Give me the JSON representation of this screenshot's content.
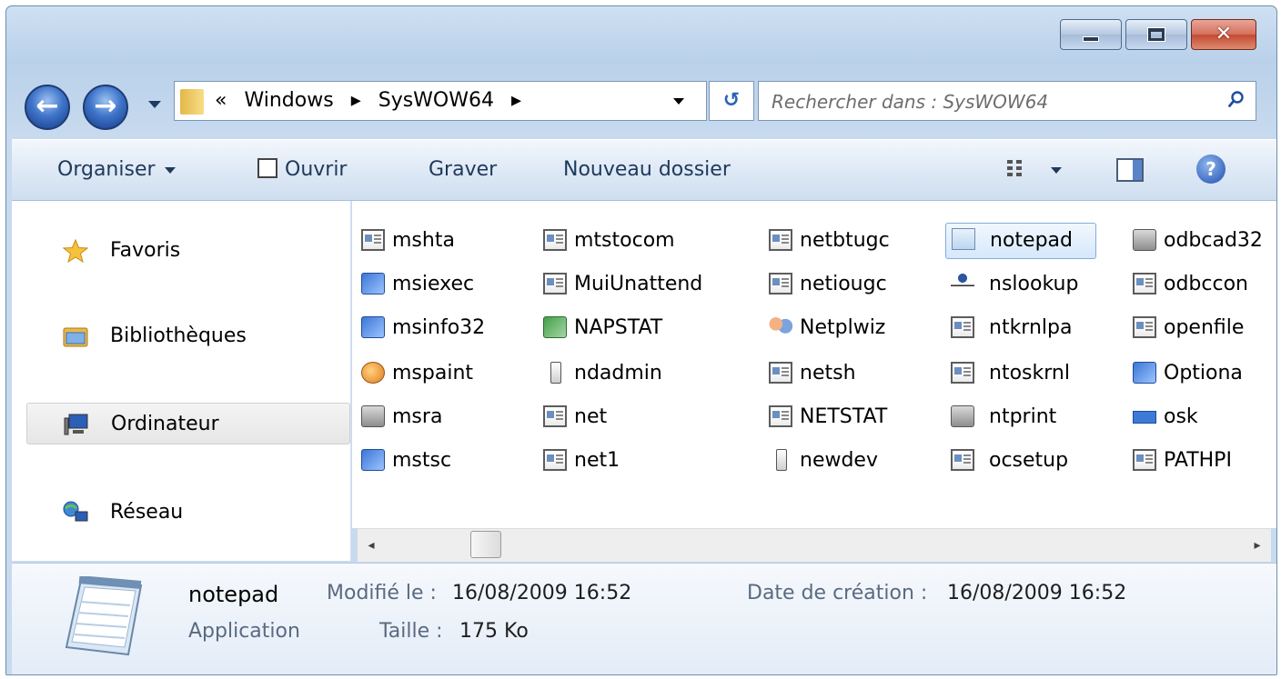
{
  "window": {
    "caption_buttons": {
      "minimize": "",
      "maximize": "",
      "close": "✕"
    }
  },
  "navigation": {
    "back": "←",
    "forward": "→",
    "breadcrumbs": [
      "«",
      "Windows",
      "▸",
      "SysWOW64",
      "▸"
    ],
    "search_placeholder": "Rechercher dans : SysWOW64",
    "refresh_glyph": "↺"
  },
  "toolbar": {
    "organiser": "Organiser",
    "ouvrir": "Ouvrir",
    "graver": "Graver",
    "nouveau_dossier": "Nouveau dossier",
    "help": "?"
  },
  "nav_pane": {
    "items": [
      {
        "label": "Favoris",
        "icon": "star-icon"
      },
      {
        "label": "Bibliothèques",
        "icon": "libraries-icon"
      },
      {
        "label": "Ordinateur",
        "icon": "computer-icon",
        "selected": true
      },
      {
        "label": "Réseau",
        "icon": "network-icon"
      }
    ]
  },
  "files": {
    "columns": [
      [
        "mshta",
        "msiexec",
        "msinfo32",
        "mspaint",
        "msra",
        "mstsc"
      ],
      [
        "mtstocom",
        "MuiUnattend",
        "NAPSTAT",
        "ndadmin",
        "net",
        "net1"
      ],
      [
        "netbtugc",
        "netiougc",
        "Netplwiz",
        "netsh",
        "NETSTAT",
        "newdev"
      ],
      [
        "notepad",
        "nslookup",
        "ntkrnlpa",
        "ntoskrnl",
        "ntprint",
        "ocsetup"
      ],
      [
        "odbcad32",
        "odbccon",
        "openfile",
        "Optiona",
        "osk",
        "PATHPI"
      ]
    ],
    "selected": "notepad"
  },
  "scrollbar": {
    "left": "◂",
    "right": "▸"
  },
  "details": {
    "name": "notepad",
    "type": "Application",
    "modified_label": "Modifié le :",
    "modified_value": "16/08/2009 16:52",
    "size_label": "Taille :",
    "size_value": "175 Ko",
    "created_label": "Date de création :",
    "created_value": "16/08/2009 16:52"
  },
  "colors": {
    "frame": "#b9d1ea",
    "selection": "#d6e8fb",
    "close_button": "#c34a33"
  }
}
